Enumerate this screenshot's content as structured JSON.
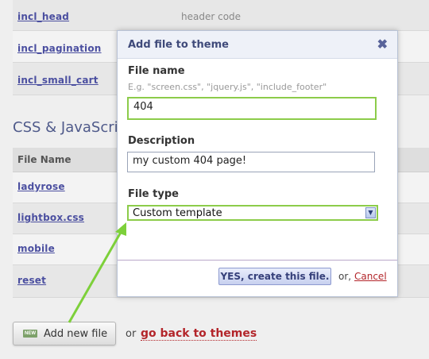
{
  "files_list": {
    "top_rows": [
      {
        "name": "incl_head",
        "description": "header code"
      },
      {
        "name": "incl_pagination",
        "description": ""
      },
      {
        "name": "incl_small_cart",
        "description": ""
      }
    ],
    "section_heading": "CSS & JavaScrip",
    "column_header": "File Name",
    "bottom_rows": [
      {
        "name": "ladyrose"
      },
      {
        "name": "lightbox.css"
      },
      {
        "name": "mobile"
      },
      {
        "name": "reset"
      }
    ]
  },
  "footer": {
    "add_button_label": "Add new file",
    "add_button_icon_text": "NEW",
    "or_text": "or",
    "back_link": "go back to themes"
  },
  "modal": {
    "title": "Add file to theme",
    "close_glyph": "✖",
    "file_name": {
      "label": "File name",
      "hint": "E.g. \"screen.css\", \"jquery.js\", \"include_footer\"",
      "value": "404"
    },
    "description": {
      "label": "Description",
      "value": "my custom 404 page!"
    },
    "file_type": {
      "label": "File type",
      "selected": "Custom template"
    },
    "submit_label": "YES, create this file.",
    "or_text": "or,",
    "cancel_label": "Cancel"
  },
  "colors": {
    "accent_green": "#8ccc4a",
    "link_red": "#b3252a",
    "link_blue": "#4b4fa0"
  }
}
